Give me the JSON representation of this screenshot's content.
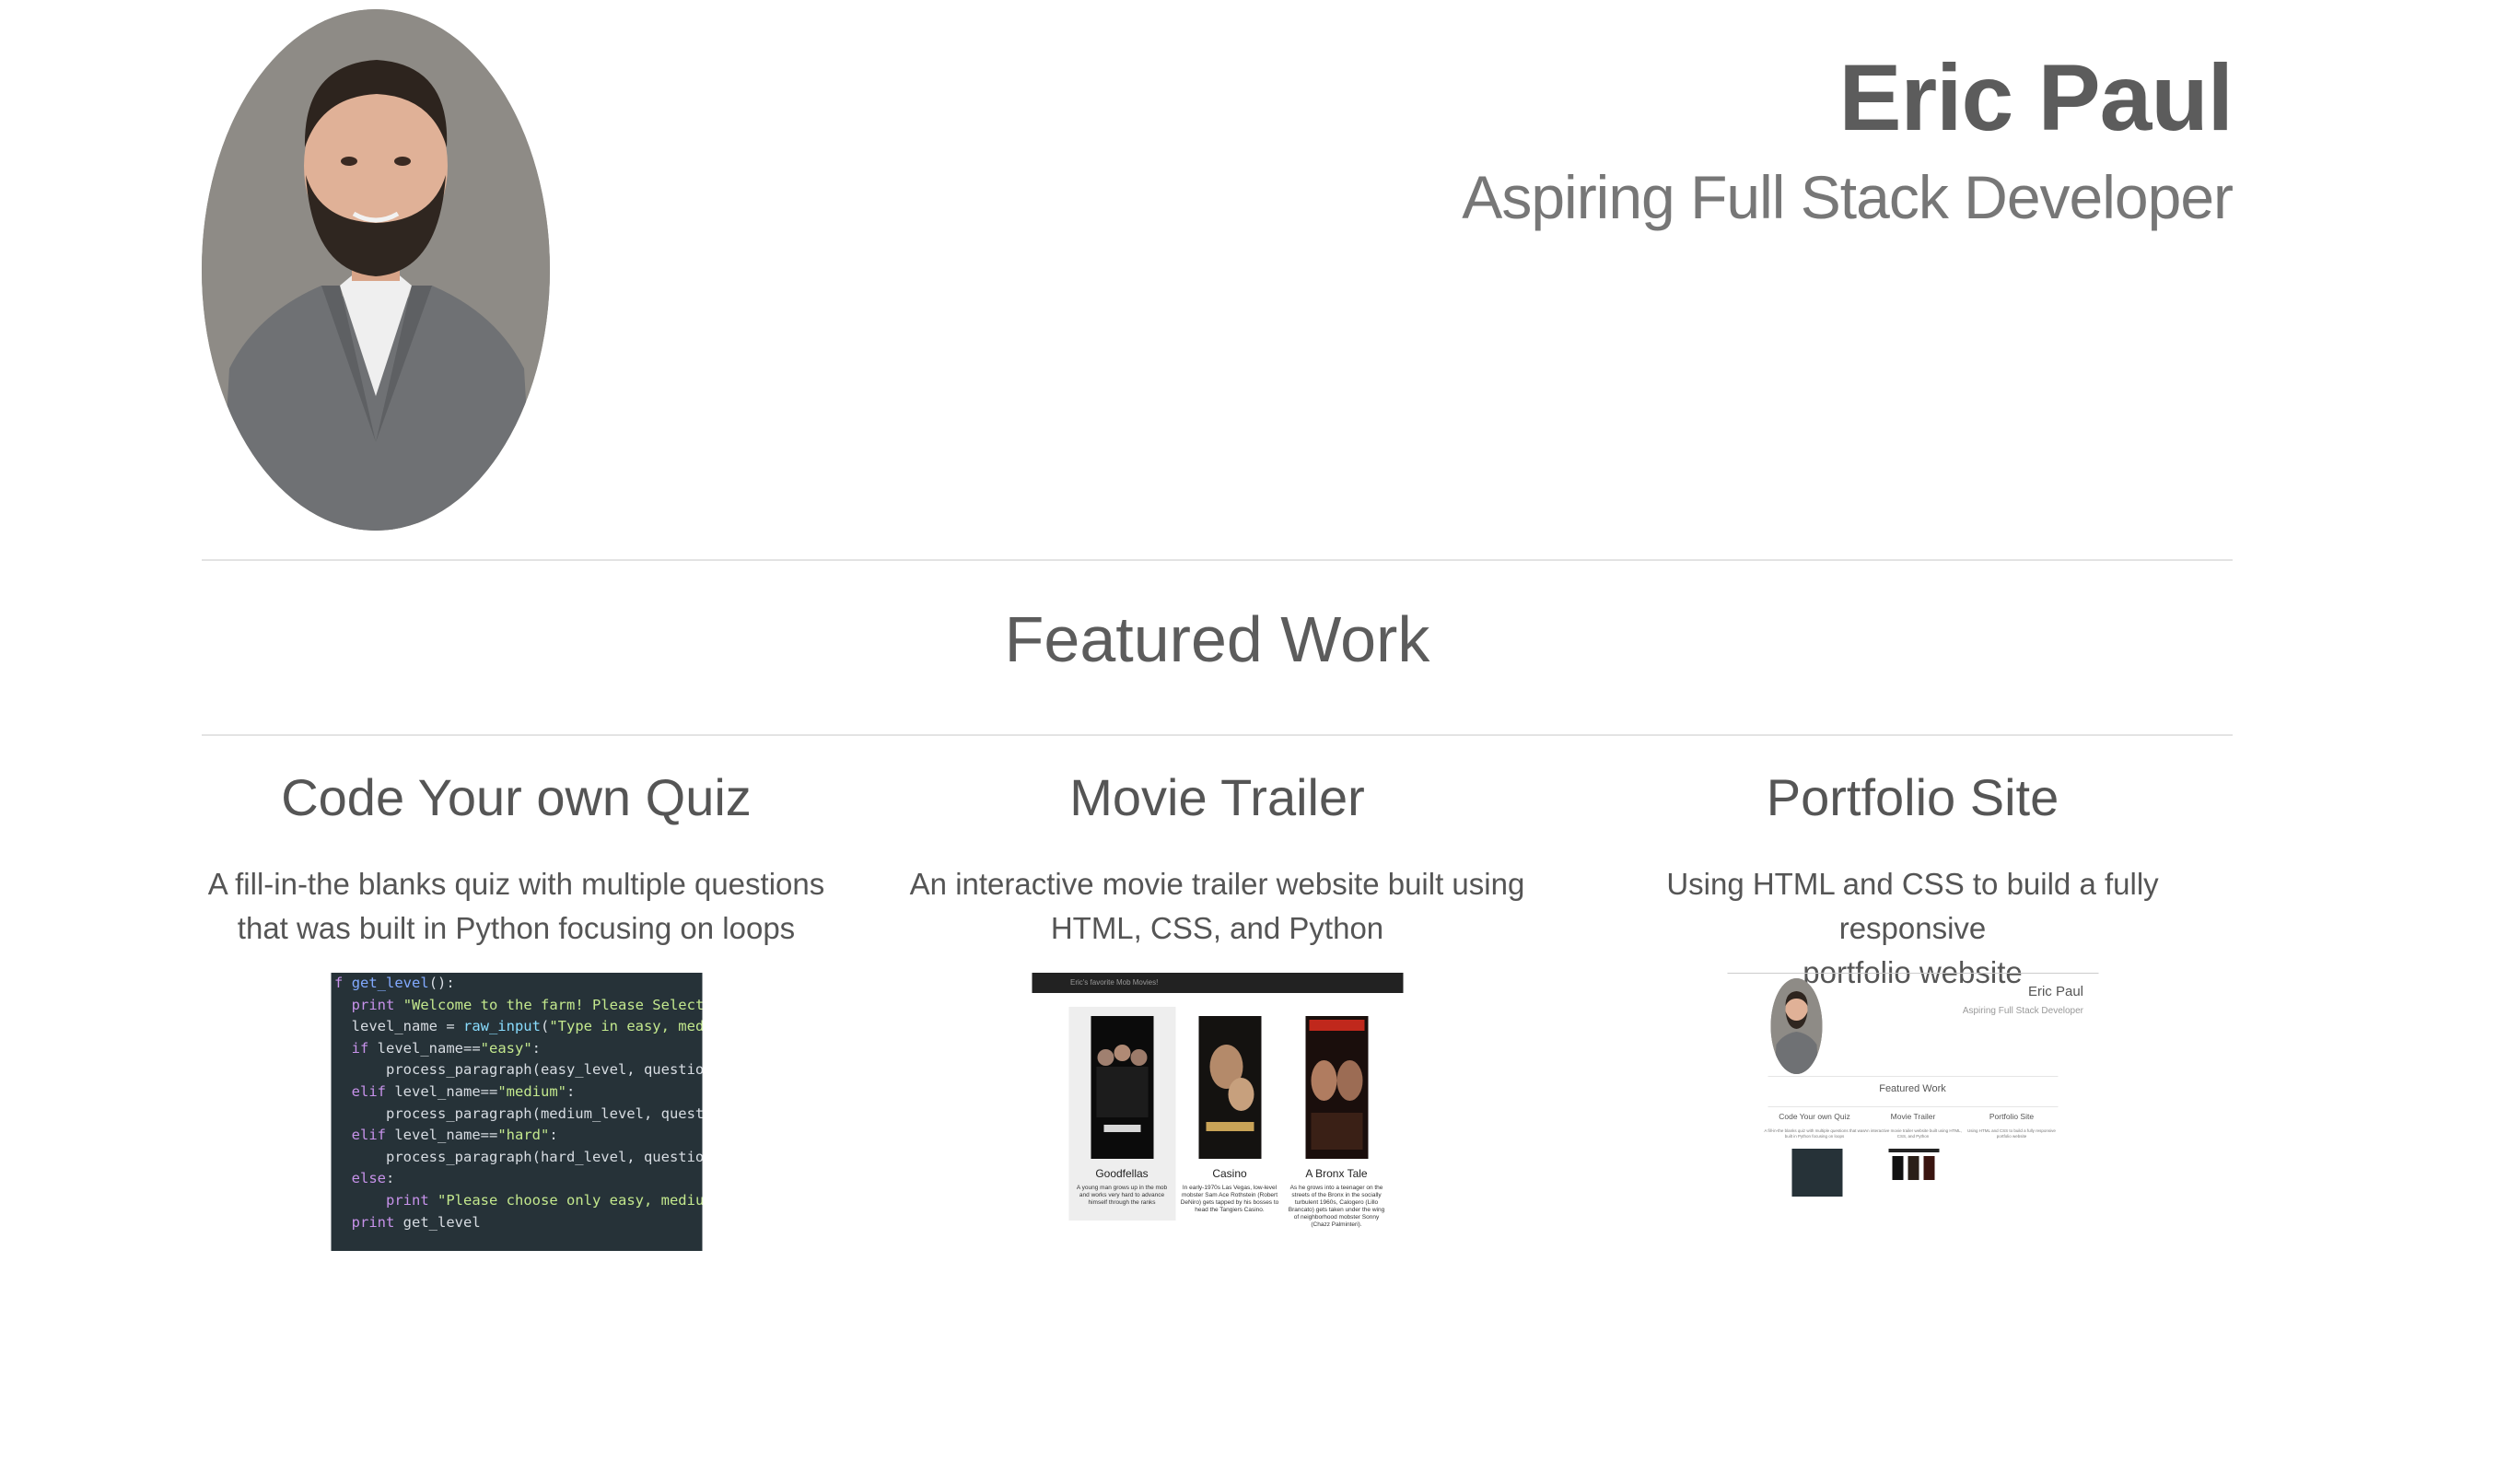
{
  "header": {
    "name": "Eric Paul",
    "subtitle": "Aspiring Full Stack Developer",
    "avatar": "profile-photo"
  },
  "featured": {
    "title": "Featured Work"
  },
  "projects": [
    {
      "title": "Code Your own Quiz",
      "description_line1": "A fill-in-the blanks quiz with multiple questions",
      "description_line2": "that was built in Python focusing on loops",
      "thumbnail": "code-screenshot"
    },
    {
      "title": "Movie Trailer",
      "description_line1": "An interactive movie trailer website built using",
      "description_line2": "HTML, CSS, and Python",
      "thumbnail": "movie-trailer-screenshot"
    },
    {
      "title": "Portfolio Site",
      "description_line1": "Using HTML and CSS to build a fully responsive",
      "description_line2": "portfolio website",
      "thumbnail": "portfolio-screenshot"
    }
  ],
  "code_thumb": {
    "lines": [
      "f get_level():",
      "  print \"Welcome to the farm! Please Select a",
      "  level_name = raw_input(\"Type in easy, mediu",
      "  if level_name==\"easy\":",
      "      process_paragraph(easy_level, questions,",
      "  elif level_name==\"medium\":",
      "      process_paragraph(medium_level, question",
      "  elif level_name==\"hard\":",
      "      process_paragraph(hard_level, questions,",
      "  else:",
      "      print \"Please choose only easy, medium o",
      "  print get_level"
    ]
  },
  "movie_thumb": {
    "bar_title": "Eric's favorite Mob Movies!",
    "movies": [
      {
        "title": "Goodfellas",
        "desc": "A young man grows up in the mob and works very hard to advance himself through the ranks"
      },
      {
        "title": "Casino",
        "desc": "In early-1970s Las Vegas, low-level mobster Sam Ace Rothstein (Robert DeNiro) gets tapped by his bosses to head the Tangiers Casino."
      },
      {
        "title": "A Bronx Tale",
        "desc": "As he grows into a teenager on the streets of the Bronx in the socially turbulent 1960s, Calogero (Lillo Brancato) gets taken under the wing of neighborhood mobster Sonny (Chazz Palminteri)."
      }
    ]
  },
  "mini_site": {
    "name": "Eric Paul",
    "subtitle": "Aspiring Full Stack Developer",
    "featured": "Featured Work",
    "columns": [
      {
        "title": "Code Your own Quiz",
        "desc": "A fill-in-the blanks quiz with multiple questions that was built in Python focusing on loops"
      },
      {
        "title": "Movie Trailer",
        "desc": "An interactive movie trailer website built using HTML, CSS, and Python"
      },
      {
        "title": "Portfolio Site",
        "desc": "Using HTML and CSS to build a fully responsive portfolio website"
      }
    ]
  },
  "colors": {
    "heading": "#5c5c5c",
    "text": "#555555",
    "rule": "#e3e3e3",
    "code_bg": "#263238"
  }
}
